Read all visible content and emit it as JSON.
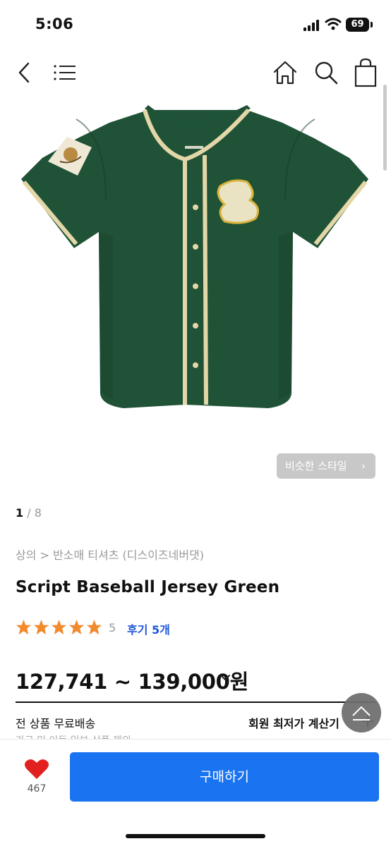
{
  "status_bar": {
    "time": "5:06",
    "battery_level": "69",
    "icons": [
      "signal-icon",
      "wifi-icon",
      "battery-icon"
    ]
  },
  "nav": {
    "icons": [
      "back-icon",
      "menu-icon",
      "home-icon",
      "search-icon",
      "cart-icon"
    ]
  },
  "product": {
    "similar_style_label": "비슷한 스타일",
    "image_index": "1",
    "image_total": " / 8",
    "breadcrumb": "상의 > 반소매 티셔츠 (디스이즈네버댓)",
    "title": "Script Baseball Jersey Green",
    "rating": "5",
    "review_link": "후기 5개",
    "price": "127,741 ~ 139,000원",
    "shipping": "전 상품 무료배송",
    "member_price": "회원 최저가 계산기",
    "cut_text": "가구 및 이동 일부 상품 제외"
  },
  "colors": {
    "accent": "#1a73f0",
    "star": "#f28b2e",
    "review_link": "#1f56d9",
    "like": "#e1201f",
    "jersey": "#1f5236"
  },
  "bottom_bar": {
    "like_count": "467",
    "buy_label": "구매하기"
  }
}
